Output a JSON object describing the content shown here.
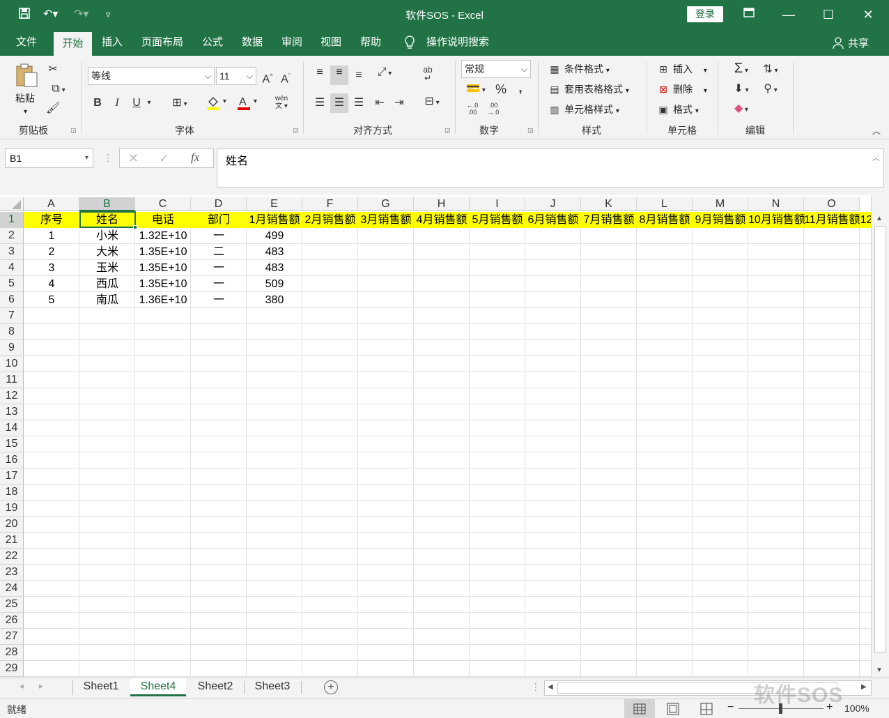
{
  "titlebar": {
    "title": "软件SOS  -  Excel",
    "login": "登录"
  },
  "menu": [
    "文件",
    "开始",
    "插入",
    "页面布局",
    "公式",
    "数据",
    "审阅",
    "视图",
    "帮助"
  ],
  "menu_search": "操作说明搜索",
  "share": "共享",
  "ribbon": {
    "clipboard": {
      "paste": "粘贴",
      "label": "剪贴板"
    },
    "font": {
      "name": "等线",
      "size": "11",
      "bold": "B",
      "italic": "I",
      "underline": "U",
      "label": "字体",
      "grow": "A",
      "shrink": "A",
      "pinyin": "wén"
    },
    "alignment": {
      "label": "对齐方式"
    },
    "number": {
      "format": "常规",
      "percent": "%",
      "comma": ",",
      "label": "数字",
      "inc": "←.0 .00",
      "dec": ".00 →.0"
    },
    "styles": {
      "conditional": "条件格式",
      "table": "套用表格格式",
      "cell": "单元格样式",
      "label": "样式"
    },
    "cells": {
      "insert": "插入",
      "delete": "删除",
      "format": "格式",
      "label": "单元格"
    },
    "editing": {
      "label": "编辑"
    }
  },
  "formula_bar": {
    "name_box": "B1",
    "content": "姓名",
    "fx": "fx"
  },
  "columns": [
    "A",
    "B",
    "C",
    "D",
    "E",
    "F",
    "G",
    "H",
    "I",
    "J",
    "K",
    "L",
    "M",
    "N",
    "O"
  ],
  "selected_column": "B",
  "selected_row": 1,
  "rows": [
    "1",
    "2",
    "3",
    "4",
    "5",
    "6",
    "7",
    "8",
    "9",
    "10",
    "11",
    "12",
    "13",
    "14",
    "15",
    "16",
    "17",
    "18",
    "19",
    "20",
    "21",
    "22",
    "23",
    "24",
    "25",
    "26",
    "27",
    "28",
    "29"
  ],
  "header_row": [
    "序号",
    "姓名",
    "电话",
    "部门",
    "1月销售额",
    "2月销售额",
    "3月销售额",
    "4月销售额",
    "5月销售额",
    "6月销售额",
    "7月销售额",
    "8月销售额",
    "9月销售额",
    "10月销售额",
    "11月销售额12"
  ],
  "data_rows": [
    [
      "1",
      "小米",
      "1.32E+10",
      "一",
      "499"
    ],
    [
      "2",
      "大米",
      "1.35E+10",
      "二",
      "483"
    ],
    [
      "3",
      "玉米",
      "1.35E+10",
      "一",
      "483"
    ],
    [
      "4",
      "西瓜",
      "1.35E+10",
      "一",
      "509"
    ],
    [
      "5",
      "南瓜",
      "1.36E+10",
      "一",
      "380"
    ]
  ],
  "sheets": [
    "Sheet1",
    "Sheet4",
    "Sheet2",
    "Sheet3"
  ],
  "active_sheet": "Sheet4",
  "status": {
    "ready": "就绪",
    "zoom": "100%"
  },
  "watermark": "软件SOS",
  "colors": {
    "brand": "#217346",
    "header_fill": "#ffff00"
  }
}
